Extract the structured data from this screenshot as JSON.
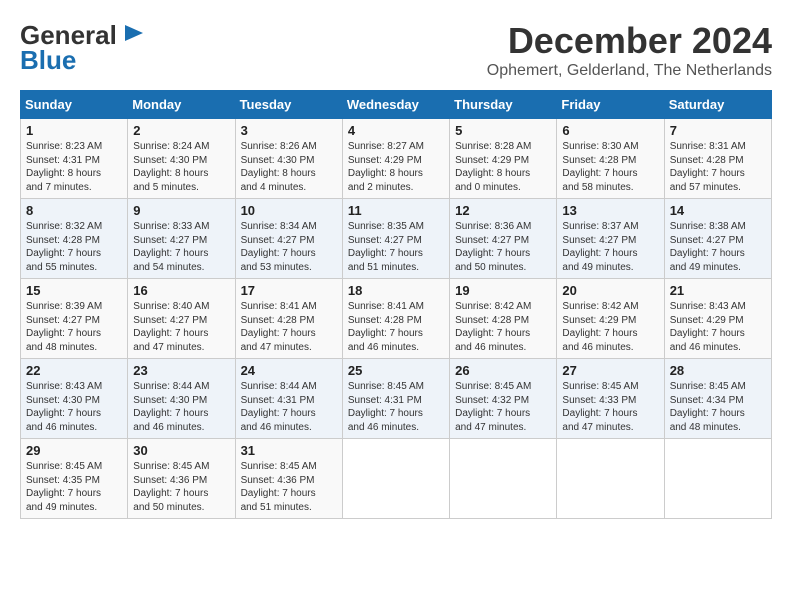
{
  "header": {
    "logo_general": "General",
    "logo_blue": "Blue",
    "month": "December 2024",
    "location": "Ophemert, Gelderland, The Netherlands"
  },
  "weekdays": [
    "Sunday",
    "Monday",
    "Tuesday",
    "Wednesday",
    "Thursday",
    "Friday",
    "Saturday"
  ],
  "weeks": [
    [
      {
        "day": "1",
        "info": "Sunrise: 8:23 AM\nSunset: 4:31 PM\nDaylight: 8 hours\nand 7 minutes."
      },
      {
        "day": "2",
        "info": "Sunrise: 8:24 AM\nSunset: 4:30 PM\nDaylight: 8 hours\nand 5 minutes."
      },
      {
        "day": "3",
        "info": "Sunrise: 8:26 AM\nSunset: 4:30 PM\nDaylight: 8 hours\nand 4 minutes."
      },
      {
        "day": "4",
        "info": "Sunrise: 8:27 AM\nSunset: 4:29 PM\nDaylight: 8 hours\nand 2 minutes."
      },
      {
        "day": "5",
        "info": "Sunrise: 8:28 AM\nSunset: 4:29 PM\nDaylight: 8 hours\nand 0 minutes."
      },
      {
        "day": "6",
        "info": "Sunrise: 8:30 AM\nSunset: 4:28 PM\nDaylight: 7 hours\nand 58 minutes."
      },
      {
        "day": "7",
        "info": "Sunrise: 8:31 AM\nSunset: 4:28 PM\nDaylight: 7 hours\nand 57 minutes."
      }
    ],
    [
      {
        "day": "8",
        "info": "Sunrise: 8:32 AM\nSunset: 4:28 PM\nDaylight: 7 hours\nand 55 minutes."
      },
      {
        "day": "9",
        "info": "Sunrise: 8:33 AM\nSunset: 4:27 PM\nDaylight: 7 hours\nand 54 minutes."
      },
      {
        "day": "10",
        "info": "Sunrise: 8:34 AM\nSunset: 4:27 PM\nDaylight: 7 hours\nand 53 minutes."
      },
      {
        "day": "11",
        "info": "Sunrise: 8:35 AM\nSunset: 4:27 PM\nDaylight: 7 hours\nand 51 minutes."
      },
      {
        "day": "12",
        "info": "Sunrise: 8:36 AM\nSunset: 4:27 PM\nDaylight: 7 hours\nand 50 minutes."
      },
      {
        "day": "13",
        "info": "Sunrise: 8:37 AM\nSunset: 4:27 PM\nDaylight: 7 hours\nand 49 minutes."
      },
      {
        "day": "14",
        "info": "Sunrise: 8:38 AM\nSunset: 4:27 PM\nDaylight: 7 hours\nand 49 minutes."
      }
    ],
    [
      {
        "day": "15",
        "info": "Sunrise: 8:39 AM\nSunset: 4:27 PM\nDaylight: 7 hours\nand 48 minutes."
      },
      {
        "day": "16",
        "info": "Sunrise: 8:40 AM\nSunset: 4:27 PM\nDaylight: 7 hours\nand 47 minutes."
      },
      {
        "day": "17",
        "info": "Sunrise: 8:41 AM\nSunset: 4:28 PM\nDaylight: 7 hours\nand 47 minutes."
      },
      {
        "day": "18",
        "info": "Sunrise: 8:41 AM\nSunset: 4:28 PM\nDaylight: 7 hours\nand 46 minutes."
      },
      {
        "day": "19",
        "info": "Sunrise: 8:42 AM\nSunset: 4:28 PM\nDaylight: 7 hours\nand 46 minutes."
      },
      {
        "day": "20",
        "info": "Sunrise: 8:42 AM\nSunset: 4:29 PM\nDaylight: 7 hours\nand 46 minutes."
      },
      {
        "day": "21",
        "info": "Sunrise: 8:43 AM\nSunset: 4:29 PM\nDaylight: 7 hours\nand 46 minutes."
      }
    ],
    [
      {
        "day": "22",
        "info": "Sunrise: 8:43 AM\nSunset: 4:30 PM\nDaylight: 7 hours\nand 46 minutes."
      },
      {
        "day": "23",
        "info": "Sunrise: 8:44 AM\nSunset: 4:30 PM\nDaylight: 7 hours\nand 46 minutes."
      },
      {
        "day": "24",
        "info": "Sunrise: 8:44 AM\nSunset: 4:31 PM\nDaylight: 7 hours\nand 46 minutes."
      },
      {
        "day": "25",
        "info": "Sunrise: 8:45 AM\nSunset: 4:31 PM\nDaylight: 7 hours\nand 46 minutes."
      },
      {
        "day": "26",
        "info": "Sunrise: 8:45 AM\nSunset: 4:32 PM\nDaylight: 7 hours\nand 47 minutes."
      },
      {
        "day": "27",
        "info": "Sunrise: 8:45 AM\nSunset: 4:33 PM\nDaylight: 7 hours\nand 47 minutes."
      },
      {
        "day": "28",
        "info": "Sunrise: 8:45 AM\nSunset: 4:34 PM\nDaylight: 7 hours\nand 48 minutes."
      }
    ],
    [
      {
        "day": "29",
        "info": "Sunrise: 8:45 AM\nSunset: 4:35 PM\nDaylight: 7 hours\nand 49 minutes."
      },
      {
        "day": "30",
        "info": "Sunrise: 8:45 AM\nSunset: 4:36 PM\nDaylight: 7 hours\nand 50 minutes."
      },
      {
        "day": "31",
        "info": "Sunrise: 8:45 AM\nSunset: 4:36 PM\nDaylight: 7 hours\nand 51 minutes."
      },
      {
        "day": "",
        "info": ""
      },
      {
        "day": "",
        "info": ""
      },
      {
        "day": "",
        "info": ""
      },
      {
        "day": "",
        "info": ""
      }
    ]
  ]
}
